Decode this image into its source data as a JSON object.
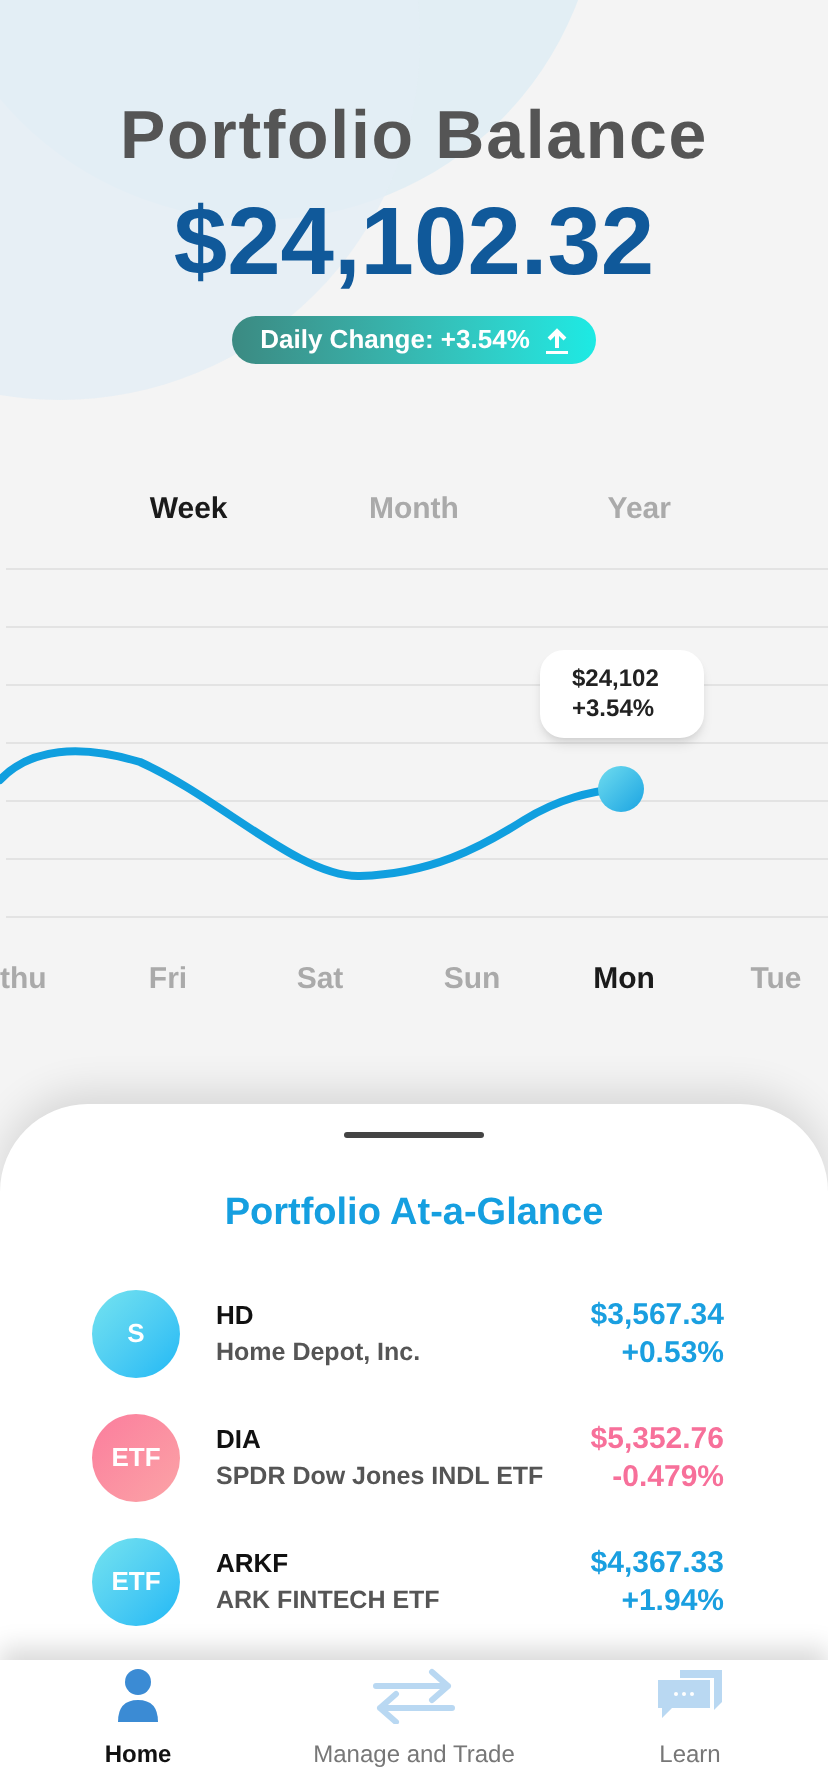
{
  "header": {
    "title": "Portfolio Balance",
    "balance": "$24,102.32",
    "daily_change": "Daily Change: +3.54%"
  },
  "period_tabs": [
    {
      "label": "Week",
      "selected": true
    },
    {
      "label": "Month",
      "selected": false
    },
    {
      "label": "Year",
      "selected": false
    }
  ],
  "chart": {
    "tooltip": [
      "$24,102",
      "+3.54%"
    ],
    "days": [
      {
        "label": "thu",
        "selected": false
      },
      {
        "label": "Fri",
        "selected": false
      },
      {
        "label": "Sat",
        "selected": false
      },
      {
        "label": "Sun",
        "selected": false
      },
      {
        "label": "Mon",
        "selected": true
      },
      {
        "label": "Tue",
        "selected": false
      }
    ]
  },
  "glance": {
    "title": "Portfolio At-a-Glance",
    "holdings": [
      {
        "badge": "S",
        "ticker": "HD",
        "name": "Home Depot, Inc.",
        "value": "$3,567.34",
        "change": "+0.53%",
        "color": "#1a9fe0"
      },
      {
        "badge": "ETF",
        "ticker": "DIA",
        "name": "SPDR Dow Jones INDL ETF",
        "value": "$5,352.76",
        "change": "-0.479%",
        "color": "#f7709a"
      },
      {
        "badge": "ETF",
        "ticker": "ARKF",
        "name": "ARK FINTECH ETF",
        "value": "$4,367.33",
        "change": "+1.94%",
        "color": "#1a9fe0"
      }
    ]
  },
  "nav": [
    {
      "kind": "home",
      "label": "Home",
      "selected": true
    },
    {
      "kind": "trade",
      "label": "Manage and Trade",
      "selected": false
    },
    {
      "kind": "learn",
      "label": "Learn",
      "selected": false
    }
  ]
}
